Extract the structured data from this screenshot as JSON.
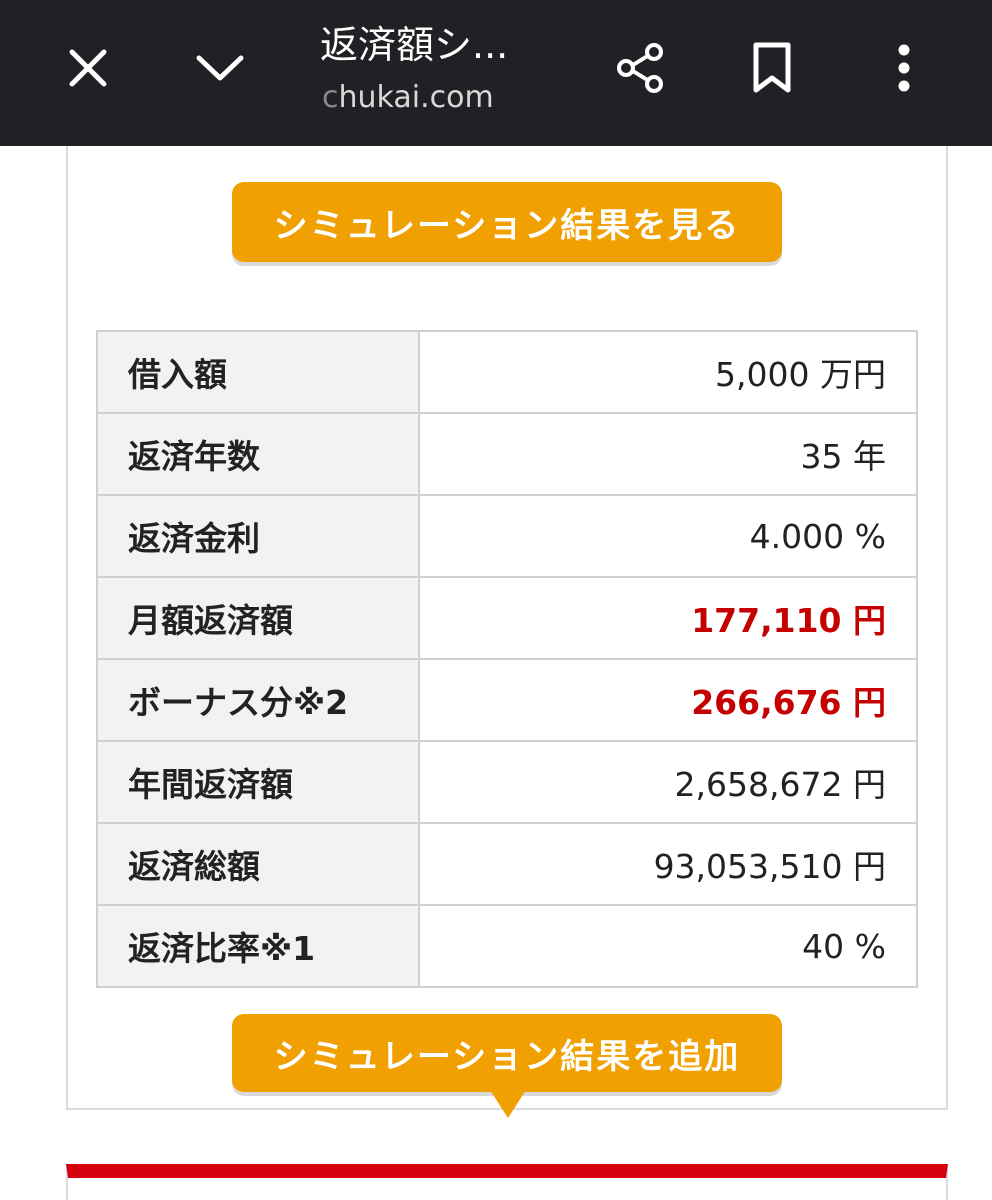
{
  "browser": {
    "title": "返済額シ...",
    "url_prefix": "c",
    "url_rest": "hukai.com",
    "icons": {
      "close": "close-icon",
      "collapse": "chevron-down-icon",
      "share": "share-icon",
      "bookmark": "bookmark-icon",
      "menu": "more-vert-icon"
    },
    "bar_color": "#202124"
  },
  "actions": {
    "view_results_label": "シミュレーション結果を見る",
    "add_results_label": "シミュレーション結果を追加",
    "button_color": "#f0a000"
  },
  "results": {
    "rows": [
      {
        "label": "借入額",
        "value": "5,000 万円",
        "highlight": false
      },
      {
        "label": "返済年数",
        "value": "35 年",
        "highlight": false
      },
      {
        "label": "返済金利",
        "value": "4.000 %",
        "highlight": false
      },
      {
        "label": "月額返済額",
        "value": "177,110 円",
        "highlight": true
      },
      {
        "label": "ボーナス分※2",
        "value": "266,676 円",
        "highlight": true
      },
      {
        "label": "年間返済額",
        "value": "2,658,672 円",
        "highlight": false
      },
      {
        "label": "返済総額",
        "value": "93,053,510 円",
        "highlight": false
      },
      {
        "label": "返済比率※1",
        "value": "40 %",
        "highlight": false
      }
    ],
    "highlight_color": "#c40000"
  },
  "next_section": {
    "accent_color": "#d7000f"
  }
}
